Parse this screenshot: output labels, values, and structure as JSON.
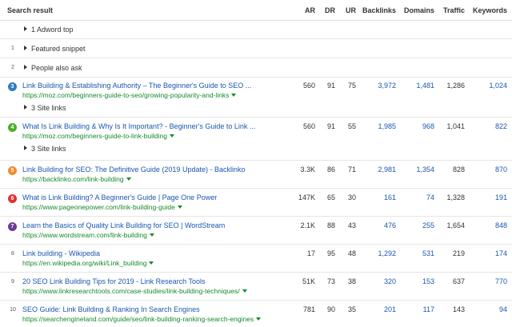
{
  "header": {
    "search_result": "Search result",
    "ar": "AR",
    "dr": "DR",
    "ur": "UR",
    "backlinks": "Backlinks",
    "domains": "Domains",
    "traffic": "Traffic",
    "keywords": "Keywords"
  },
  "adword": {
    "label": "1 Adword top"
  },
  "featured": {
    "pos": "1",
    "label": "Featured snippet"
  },
  "people": {
    "pos": "2",
    "label": "People also ask"
  },
  "results": [
    {
      "pos": "3",
      "color": "#2f7cc5",
      "title": "Link Building & Establishing Authority – The Beginner's Guide to SEO ...",
      "url": "https://moz.com/beginners-guide-to-seo/growing-popularity-and-links",
      "ar": "560",
      "dr": "91",
      "ur": "75",
      "backlinks": "3,972",
      "domains": "1,481",
      "traffic": "1,286",
      "keywords": "1,024",
      "sitelinks": "3 Site links"
    },
    {
      "pos": "4",
      "color": "#4caf2e",
      "title": "What Is Link Building & Why Is It Important? - Beginner's Guide to Link ...",
      "url": "https://moz.com/beginners-guide-to-link-building",
      "ar": "560",
      "dr": "91",
      "ur": "55",
      "backlinks": "1,985",
      "domains": "968",
      "traffic": "1,041",
      "keywords": "822",
      "sitelinks": "3 Site links"
    },
    {
      "pos": "5",
      "color": "#f08c2a",
      "title": "Link Building for SEO: The Definitive Guide (2019 Update) - Backlinko",
      "url": "https://backlinko.com/link-building",
      "ar": "3.3K",
      "dr": "86",
      "ur": "71",
      "backlinks": "2,981",
      "domains": "1,354",
      "traffic": "828",
      "keywords": "870"
    },
    {
      "pos": "6",
      "color": "#e0312f",
      "title": "What is Link Building? A Beginner's Guide | Page One Power",
      "url": "https://www.pageonepower.com/link-building-guide",
      "ar": "147K",
      "dr": "65",
      "ur": "30",
      "backlinks": "161",
      "domains": "74",
      "traffic": "1,328",
      "keywords": "191"
    },
    {
      "pos": "7",
      "color": "#6a3c96",
      "title": "Learn the Basics of Quality Link Building for SEO | WordStream",
      "url": "https://www.wordstream.com/link-building",
      "ar": "2.1K",
      "dr": "88",
      "ur": "43",
      "backlinks": "476",
      "domains": "255",
      "traffic": "1,654",
      "keywords": "848"
    },
    {
      "pos": "8",
      "color": "",
      "title": "Link building - Wikipedia",
      "url": "https://en.wikipedia.org/wiki/Link_building",
      "ar": "17",
      "dr": "95",
      "ur": "48",
      "backlinks": "1,292",
      "domains": "531",
      "traffic": "219",
      "keywords": "174"
    },
    {
      "pos": "9",
      "color": "",
      "title": "20 SEO Link Building Tips for 2019 - Link Research Tools",
      "url": "https://www.linkresearchtools.com/case-studies/link-building-techniques/",
      "ar": "51K",
      "dr": "73",
      "ur": "38",
      "backlinks": "320",
      "domains": "153",
      "traffic": "637",
      "keywords": "770"
    },
    {
      "pos": "10",
      "color": "",
      "title": "SEO Guide: Link Building & Ranking In Search Engines",
      "url": "https://searchengineland.com/guide/seo/link-building-ranking-search-engines",
      "ar": "781",
      "dr": "90",
      "ur": "35",
      "backlinks": "201",
      "domains": "117",
      "traffic": "143",
      "keywords": "94"
    }
  ]
}
